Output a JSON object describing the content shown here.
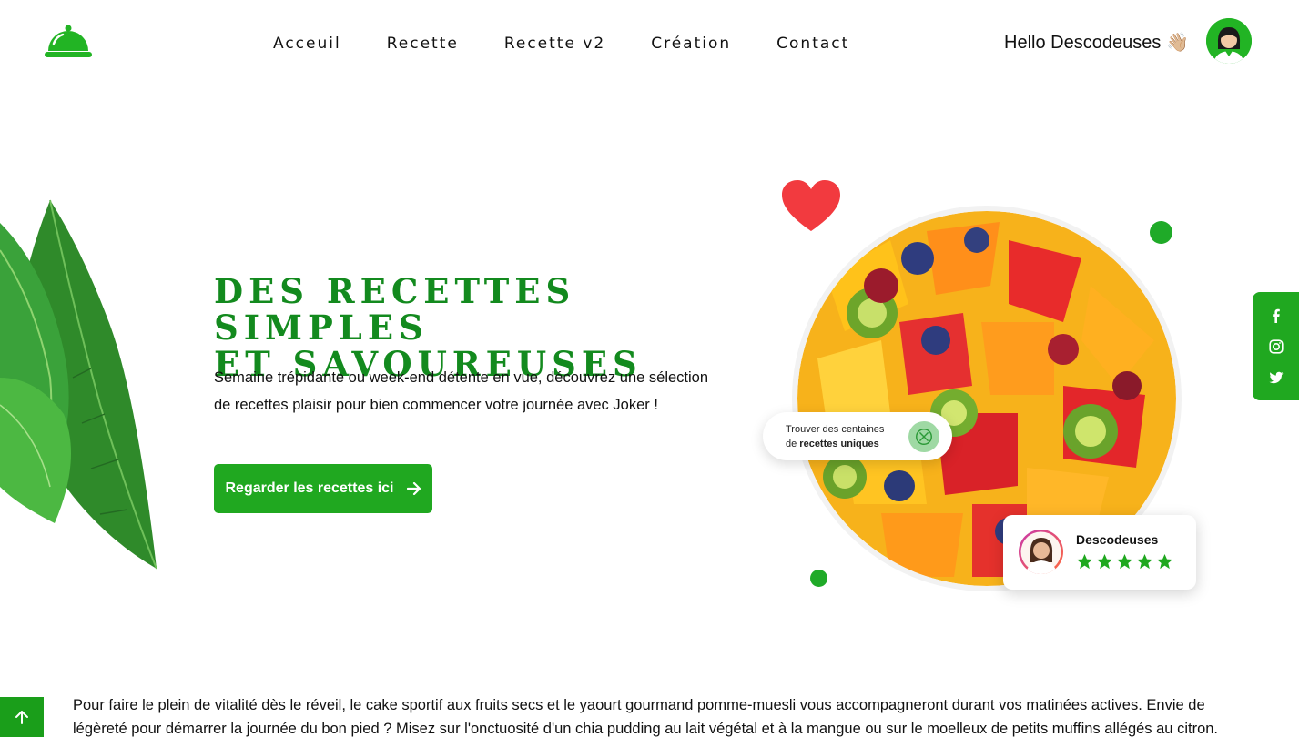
{
  "header": {
    "nav": [
      {
        "label": "Acceuil"
      },
      {
        "label": "Recette"
      },
      {
        "label": "Recette v2"
      },
      {
        "label": "Création"
      },
      {
        "label": "Contact"
      }
    ],
    "greeting": "Hello Descodeuses",
    "greeting_emoji": "👋🏼"
  },
  "hero": {
    "title_line1": "Des recettes simples",
    "title_line2": "et savoureuses",
    "description": "Semaine trépidante ou week-end détente en vue, découvrez une sélection de recettes plaisir pour bien commencer votre journée avec Joker !",
    "cta_label": "Regarder les recettes ici"
  },
  "find_card": {
    "line1": "Trouver des centaines",
    "line2_prefix": "de ",
    "line2_bold": "recettes uniques"
  },
  "review_card": {
    "name": "Descodeuses",
    "rating": 5
  },
  "body": {
    "paragraph": "Pour faire le plein de vitalité dès le réveil, le cake sportif aux fruits secs et le yaourt gourmand pomme-muesli vous accompagneront durant vos matinées actives. Envie de légèreté pour démarrer la journée du bon pied ? Misez sur l'onctuosité d'un chia pudding au lait végétal et à la mangue ou sur le moelleux de petits muffins allégés au citron. Pour un brunch"
  },
  "colors": {
    "brand_green": "#20a820",
    "title_green": "#138a1e",
    "heart_red": "#f23a3f"
  },
  "icons": [
    "cloche-logo-icon",
    "wave-hand",
    "arrow-right-icon",
    "heart-icon",
    "recipe-icon",
    "star-icon",
    "facebook-icon",
    "instagram-icon",
    "twitter-icon",
    "arrow-up-icon"
  ]
}
